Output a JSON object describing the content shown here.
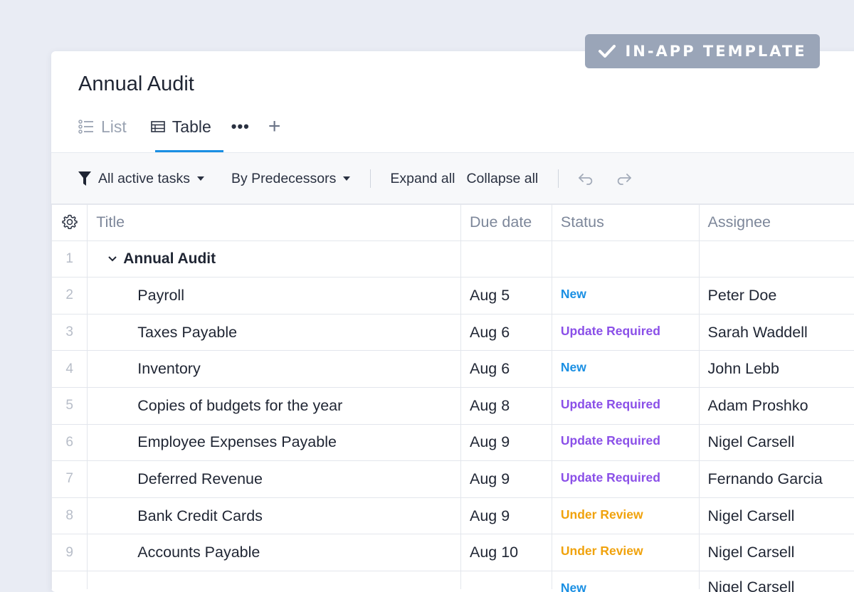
{
  "badge": {
    "label": "IN-APP TEMPLATE",
    "icon": "check-icon"
  },
  "page": {
    "title": "Annual Audit"
  },
  "tabs": [
    {
      "label": "List",
      "icon": "list-icon"
    },
    {
      "label": "Table",
      "icon": "table-icon",
      "active": true
    }
  ],
  "tabs_more": "•••",
  "tabs_add": "+",
  "toolbar": {
    "filter_label": "All active tasks",
    "group_label": "By Predecessors",
    "expand_label": "Expand all",
    "collapse_label": "Collapse all"
  },
  "table": {
    "headers": {
      "title": "Title",
      "due": "Due date",
      "status": "Status",
      "assignee": "Assignee"
    },
    "group": {
      "num": "1",
      "title": "Annual Audit"
    },
    "rows": [
      {
        "num": "2",
        "title": "Payroll",
        "due": "Aug 5",
        "status": "New",
        "status_type": "new",
        "assignee": "Peter Doe"
      },
      {
        "num": "3",
        "title": "Taxes Payable",
        "due": "Aug 6",
        "status": "Update Required",
        "status_type": "upd",
        "assignee": "Sarah Waddell"
      },
      {
        "num": "4",
        "title": "Inventory",
        "due": "Aug 6",
        "status": "New",
        "status_type": "new",
        "assignee": "John Lebb"
      },
      {
        "num": "5",
        "title": "Copies of budgets for the year",
        "due": "Aug 8",
        "status": "Update Required",
        "status_type": "upd",
        "assignee": "Adam Proshko"
      },
      {
        "num": "6",
        "title": "Employee Expenses Payable",
        "due": "Aug 9",
        "status": "Update Required",
        "status_type": "upd",
        "assignee": "Nigel Carsell"
      },
      {
        "num": "7",
        "title": "Deferred Revenue",
        "due": "Aug 9",
        "status": "Update Required",
        "status_type": "upd",
        "assignee": "Fernando Garcia"
      },
      {
        "num": "8",
        "title": "Bank Credit Cards",
        "due": "Aug 9",
        "status": "Under Review",
        "status_type": "rev",
        "assignee": "Nigel Carsell"
      },
      {
        "num": "9",
        "title": "Accounts Payable",
        "due": "Aug 10",
        "status": "Under Review",
        "status_type": "rev",
        "assignee": "Nigel Carsell"
      }
    ],
    "partial_row": {
      "status": "New",
      "assignee": "Nigel Carsell"
    }
  },
  "colors": {
    "accent": "#1a8fe3",
    "status_new": "#1a8fe3",
    "status_update": "#8a4fe8",
    "status_review": "#f0a20c",
    "badge_bg": "#9aa5b8"
  }
}
